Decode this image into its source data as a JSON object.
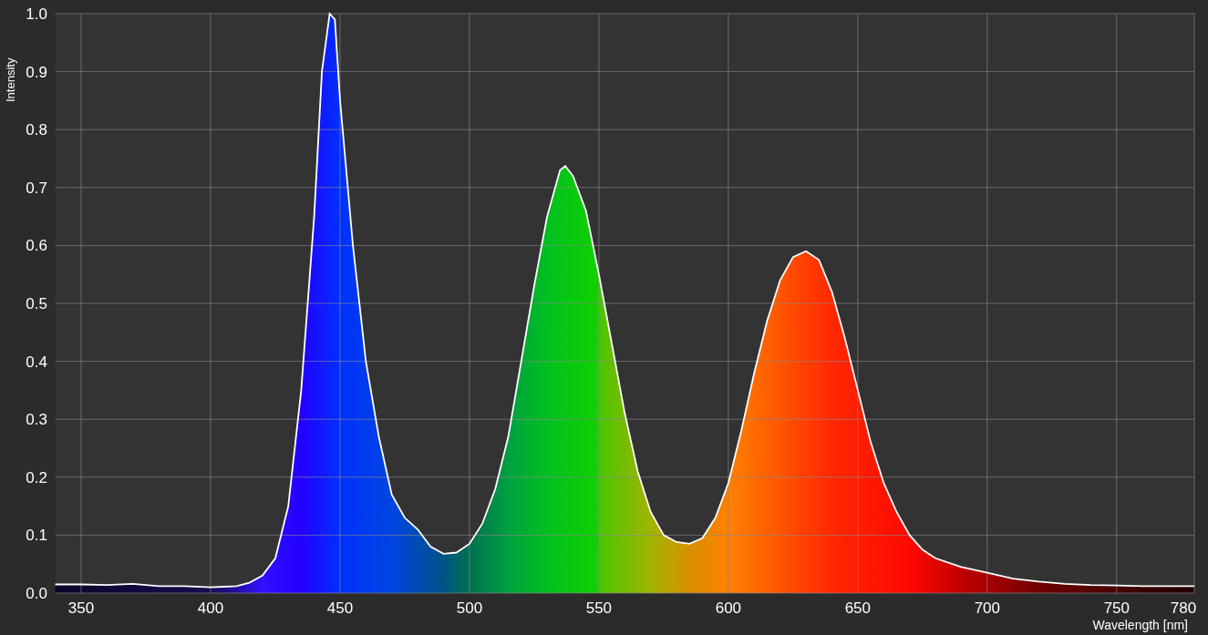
{
  "chart": {
    "chart_data": {
      "type": "area",
      "xlabel": "Wavelength [nm]",
      "ylabel": "Intensity",
      "x": [
        340,
        350,
        360,
        370,
        380,
        390,
        400,
        405,
        410,
        415,
        420,
        425,
        430,
        435,
        440,
        443,
        446,
        448,
        450,
        455,
        460,
        465,
        470,
        475,
        480,
        485,
        490,
        495,
        500,
        505,
        510,
        515,
        520,
        525,
        530,
        535,
        537,
        540,
        545,
        550,
        555,
        560,
        565,
        570,
        575,
        580,
        585,
        590,
        595,
        600,
        605,
        610,
        615,
        620,
        625,
        630,
        635,
        640,
        645,
        650,
        655,
        660,
        665,
        670,
        675,
        680,
        690,
        700,
        710,
        720,
        730,
        740,
        750,
        760,
        770,
        780
      ],
      "grid": true,
      "series": [
        {
          "color": "#ffffff",
          "values": [
            0.015,
            0.015,
            0.014,
            0.016,
            0.012,
            0.012,
            0.01,
            0.011,
            0.012,
            0.018,
            0.03,
            0.06,
            0.15,
            0.35,
            0.65,
            0.9,
            1.0,
            0.99,
            0.85,
            0.6,
            0.4,
            0.27,
            0.17,
            0.13,
            0.11,
            0.08,
            0.068,
            0.07,
            0.085,
            0.12,
            0.18,
            0.27,
            0.4,
            0.53,
            0.65,
            0.73,
            0.737,
            0.72,
            0.66,
            0.55,
            0.43,
            0.31,
            0.21,
            0.14,
            0.1,
            0.088,
            0.085,
            0.095,
            0.13,
            0.19,
            0.28,
            0.38,
            0.47,
            0.54,
            0.58,
            0.59,
            0.575,
            0.52,
            0.44,
            0.35,
            0.26,
            0.19,
            0.14,
            0.1,
            0.075,
            0.06,
            0.045,
            0.035,
            0.025,
            0.02,
            0.016,
            0.014,
            0.013,
            0.012,
            0.012,
            0.012
          ]
        }
      ],
      "xlim": [
        340,
        780
      ],
      "ylim": [
        0,
        1
      ],
      "xticks": [
        350,
        400,
        450,
        500,
        550,
        600,
        650,
        700,
        750,
        780
      ],
      "yticks": [
        {
          "value": 0,
          "label": "0.0"
        },
        {
          "value": 0.1,
          "label": "0.1"
        },
        {
          "value": 0.2,
          "label": "0.2"
        },
        {
          "value": 0.3,
          "label": "0.3"
        },
        {
          "value": 0.4,
          "label": "0.4"
        },
        {
          "value": 0.5,
          "label": "0.5"
        },
        {
          "value": 0.6,
          "label": "0.6"
        },
        {
          "value": 0.7,
          "label": "0.7"
        },
        {
          "value": 0.8,
          "label": "0.8"
        },
        {
          "value": 0.9,
          "label": "0.9"
        },
        {
          "value": 1,
          "label": "1.0"
        }
      ]
    }
  }
}
